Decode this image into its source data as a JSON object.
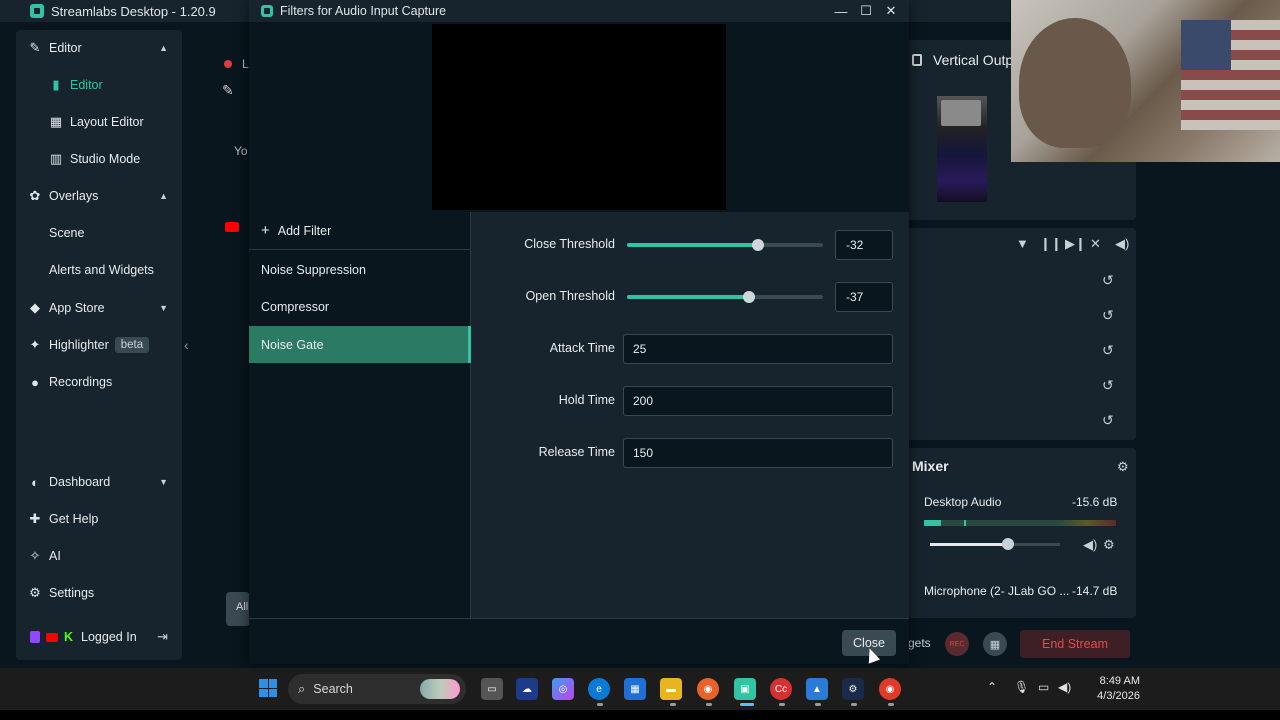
{
  "app": {
    "title": "Streamlabs Desktop - 1.20.9"
  },
  "sidebar": {
    "items": [
      {
        "label": "Editor",
        "icon": "pencil-icon"
      },
      {
        "label": "Editor",
        "icon": "editor-icon"
      },
      {
        "label": "Layout Editor",
        "icon": "layout-icon"
      },
      {
        "label": "Studio Mode",
        "icon": "studio-icon"
      },
      {
        "label": "Overlays",
        "icon": "overlays-icon"
      },
      {
        "label": "Scene"
      },
      {
        "label": "Alerts and Widgets"
      },
      {
        "label": "App Store",
        "icon": "store-icon"
      },
      {
        "label": "Highlighter",
        "icon": "highlighter-icon",
        "badge": "beta"
      },
      {
        "label": "Recordings",
        "icon": "recordings-icon"
      },
      {
        "label": "Dashboard",
        "icon": "dashboard-icon"
      },
      {
        "label": "Get Help",
        "icon": "help-icon"
      },
      {
        "label": "AI",
        "icon": "ai-icon"
      },
      {
        "label": "Settings",
        "icon": "settings-icon"
      },
      {
        "label": "Logged In"
      }
    ]
  },
  "background": {
    "scene_label_fragment": "L",
    "you_fragment": "Yo",
    "all_fragment": "All"
  },
  "right": {
    "vertical_output": "Vertical Outp",
    "mixer_title": "Mixer",
    "desktop_audio": {
      "name": "Desktop Audio",
      "db": "-15.6 dB",
      "meter_level_pct": 9,
      "volume_pct": 60
    },
    "microphone": {
      "name": "Microphone (2- JLab GO ...",
      "db": "-14.7 dB"
    },
    "gets_fragment": "gets",
    "end_stream": "End Stream"
  },
  "dialog": {
    "title": "Filters for Audio Input Capture",
    "add_filter": "Add Filter",
    "filters": [
      "Noise Suppression",
      "Compressor",
      "Noise Gate"
    ],
    "selected_filter": "Noise Gate",
    "settings": {
      "close_threshold": {
        "label": "Close Threshold",
        "value": "-32",
        "slider_pct": 67
      },
      "open_threshold": {
        "label": "Open Threshold",
        "value": "-37",
        "slider_pct": 62
      },
      "attack_time": {
        "label": "Attack Time",
        "value": "25"
      },
      "hold_time": {
        "label": "Hold Time",
        "value": "200"
      },
      "release_time": {
        "label": "Release Time",
        "value": "150"
      }
    },
    "close_button": "Close"
  },
  "taskbar": {
    "search_label": "Search",
    "time": "8:49 AM",
    "date": "4/3/2026"
  },
  "colors": {
    "accent": "#31c3a2",
    "selected_row": "#2b7a63",
    "panel": "#17242d",
    "background": "#09161d",
    "danger": "#e84a4a"
  }
}
